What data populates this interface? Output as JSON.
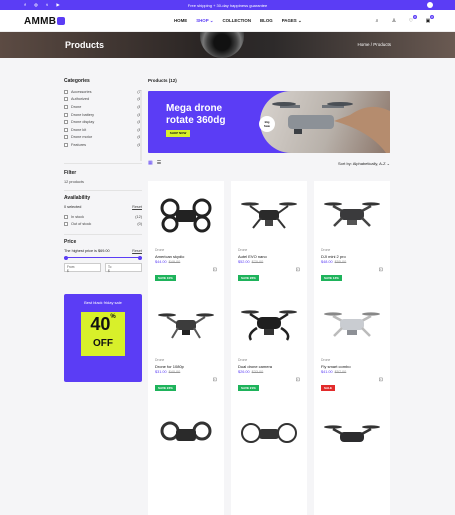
{
  "topbar": {
    "social": [
      "f",
      "◎",
      "t",
      "▶"
    ],
    "announcement": "Free shipping + 30-day happiness guarantee"
  },
  "header": {
    "logo": "AMMB",
    "nav": [
      {
        "label": "HOME"
      },
      {
        "label": "SHOP ⌄"
      },
      {
        "label": "COLLECTION"
      },
      {
        "label": "BLOG"
      },
      {
        "label": "PAGES ⌄"
      }
    ],
    "cart_count": "0",
    "wishlist_count": "0"
  },
  "banner": {
    "title": "Products",
    "breadcrumb": "Home / Products"
  },
  "sidebar": {
    "categories_title": "Categories",
    "categories": [
      {
        "name": "Accessories",
        "count": "(7)"
      },
      {
        "name": "Authorized",
        "count": "(6)"
      },
      {
        "name": "Drone",
        "count": "(8)"
      },
      {
        "name": "Drone battery",
        "count": "(8)"
      },
      {
        "name": "Drone display",
        "count": "(8)"
      },
      {
        "name": "Drone kit",
        "count": "(8)"
      },
      {
        "name": "Drone motor",
        "count": "(6)"
      },
      {
        "name": "Features",
        "count": "(6)"
      }
    ],
    "filter_title": "Filter",
    "filter_count": "12 products",
    "availability_title": "Availability",
    "selected": "0 selected",
    "reset": "Reset",
    "availability": [
      {
        "name": "In stock",
        "count": "(12)"
      },
      {
        "name": "Out of stock",
        "count": "(0)"
      }
    ],
    "price_title": "Price",
    "price_note": "The highest price is $69.00",
    "price_from_label": "From",
    "price_from": "$",
    "price_to_label": "To",
    "price_to": "$",
    "promo": {
      "title": "Best black friday sale",
      "percent": "40",
      "percent_sign": "%",
      "off": "OFF"
    }
  },
  "main": {
    "heading": "Products (12)",
    "hero": {
      "title_line1": "Mega drone",
      "title_line2": "rotate 360dg",
      "button": "SHOP NOW",
      "badge_line1": "Big",
      "badge_line2": "Sale"
    },
    "sort_label": "Sort by:",
    "sort_value": "Alphabetically, A-Z  ⌄"
  },
  "products": [
    {
      "category": "Drone",
      "name": "American skydio",
      "price": "$44.00",
      "old_price": "$49.00",
      "tag": "SAVE 10%",
      "tag_color": "green"
    },
    {
      "category": "Drone",
      "name": "Autel EVO nano",
      "price": "$52.00",
      "old_price": "$70.00",
      "tag": "SAVE 26%",
      "tag_color": "green"
    },
    {
      "category": "Drone",
      "name": "DJI mini 2 pro",
      "price": "$48.00",
      "old_price": "$55.00",
      "tag": "SAVE 13%",
      "tag_color": "green"
    },
    {
      "category": "Drone",
      "name": "Drone for 1080p",
      "price": "$31.00",
      "old_price": "$40.00",
      "tag": "SAVE 23%",
      "tag_color": "green"
    },
    {
      "category": "Drone",
      "name": "Dual drone camera",
      "price": "$26.00",
      "old_price": "$33.00",
      "tag": "SAVE 21%",
      "tag_color": "green"
    },
    {
      "category": "Drone",
      "name": "Fly smart combo",
      "price": "$41.00",
      "old_price": "$57.00",
      "tag": "SALE",
      "tag_color": "red"
    },
    {
      "category": "",
      "name": "",
      "price": "",
      "old_price": "",
      "tag": "",
      "tag_color": ""
    },
    {
      "category": "",
      "name": "",
      "price": "",
      "old_price": "",
      "tag": "",
      "tag_color": ""
    },
    {
      "category": "",
      "name": "",
      "price": "",
      "old_price": "",
      "tag": "",
      "tag_color": ""
    }
  ],
  "colors": {
    "accent": "#5b3df5",
    "lime": "#d8f02a",
    "save_green": "#1eb35b",
    "sale_red": "#e22b2b"
  }
}
